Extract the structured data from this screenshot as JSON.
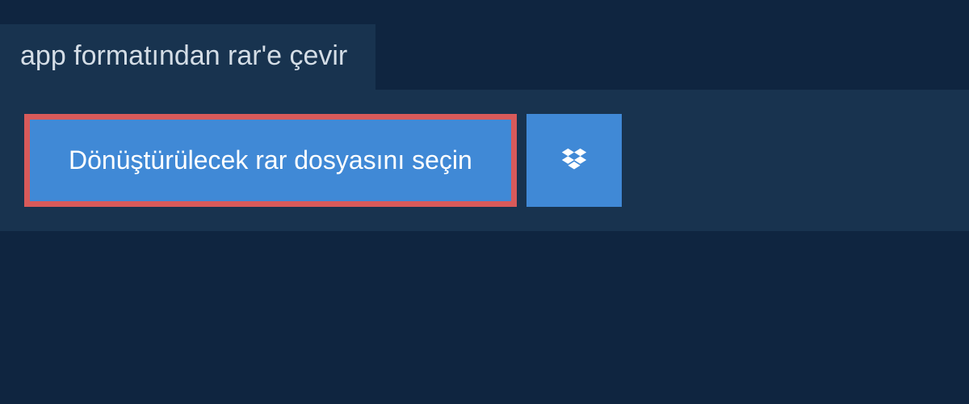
{
  "header": {
    "title": "app formatından rar'e çevir"
  },
  "main": {
    "select_button_label": "Dönüştürülecek rar dosyasını seçin"
  }
}
